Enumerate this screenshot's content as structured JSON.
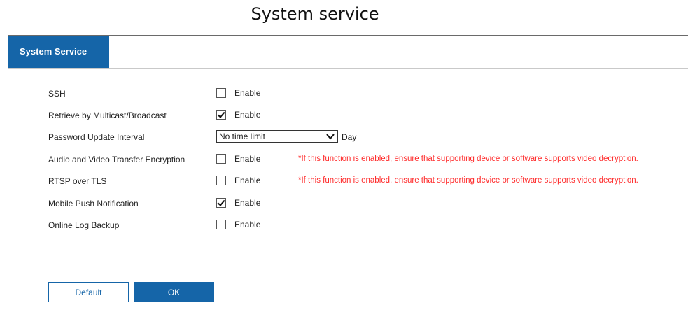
{
  "caption": "System service",
  "tab": {
    "label": "System Service"
  },
  "rows": [
    {
      "label": "SSH",
      "checked": false,
      "option": "Enable"
    },
    {
      "label": "Retrieve by Multicast/Broadcast",
      "checked": true,
      "option": "Enable"
    },
    {
      "label": "Password Update Interval",
      "select_value": "No time limit",
      "unit": "Day"
    },
    {
      "label": "Audio and Video Transfer Encryption",
      "checked": false,
      "option": "Enable",
      "warning": "*If this function is enabled, ensure that supporting device or software supports video decryption."
    },
    {
      "label": "RTSP over TLS",
      "checked": false,
      "option": "Enable",
      "warning": "*If this function is enabled, ensure that supporting device or software supports video decryption."
    },
    {
      "label": "Mobile Push Notification",
      "checked": true,
      "option": "Enable"
    },
    {
      "label": "Online Log Backup",
      "checked": false,
      "option": "Enable"
    }
  ],
  "buttons": {
    "default": "Default",
    "ok": "OK"
  },
  "colors": {
    "accent": "#1565a8",
    "warning": "#ff2a2a"
  }
}
